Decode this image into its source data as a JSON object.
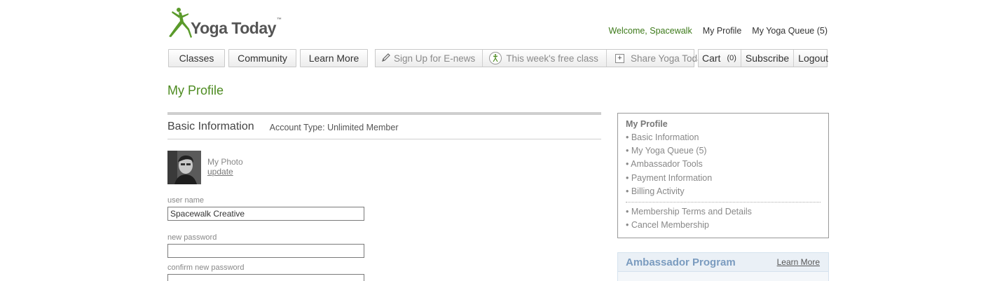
{
  "header": {
    "logo_text": "Yoga Today",
    "logo_tm": "™",
    "welcome": "Welcome, Spacewalk",
    "my_profile_link": "My Profile",
    "yoga_queue_link": "My Yoga Queue (5)"
  },
  "nav": {
    "classes": "Classes",
    "community": "Community",
    "learn_more": "Learn More",
    "signup": "Sign Up for E-news",
    "free_class": "This week's free class",
    "share": "Share Yoga Today",
    "cart": "Cart",
    "cart_count": "(0)",
    "subscribe": "Subscribe",
    "logout": "Logout"
  },
  "page": {
    "title": "My Profile"
  },
  "basic_info": {
    "title": "Basic Information",
    "account_type": "Account Type: Unlimited Member",
    "photo_label": "My Photo",
    "photo_update": "update",
    "username_label": "user name",
    "username_value": "Spacewalk Creative",
    "new_password_label": "new password",
    "new_password_value": "",
    "confirm_password_label": "confirm new password",
    "confirm_password_value": ""
  },
  "sidebar": {
    "heading": "My Profile",
    "items": [
      "• Basic Information",
      "• My Yoga Queue (5)",
      "• Ambassador Tools",
      "• Payment Information",
      "• Billing Activity"
    ],
    "items2": [
      "• Membership Terms and Details",
      "• Cancel Membership"
    ]
  },
  "ambassador": {
    "title": "Ambassador Program",
    "link": "Learn More"
  },
  "colors": {
    "brand_green": "#4d8b21",
    "welcome_green": "#3d7a1a",
    "ambassador_blue": "#7a9bbf"
  },
  "icons": {
    "logo": "yoga-pose-figure",
    "signup": "pencil-icon",
    "free_class": "yoga-figure-circle-icon",
    "share": "plus-box-icon"
  }
}
